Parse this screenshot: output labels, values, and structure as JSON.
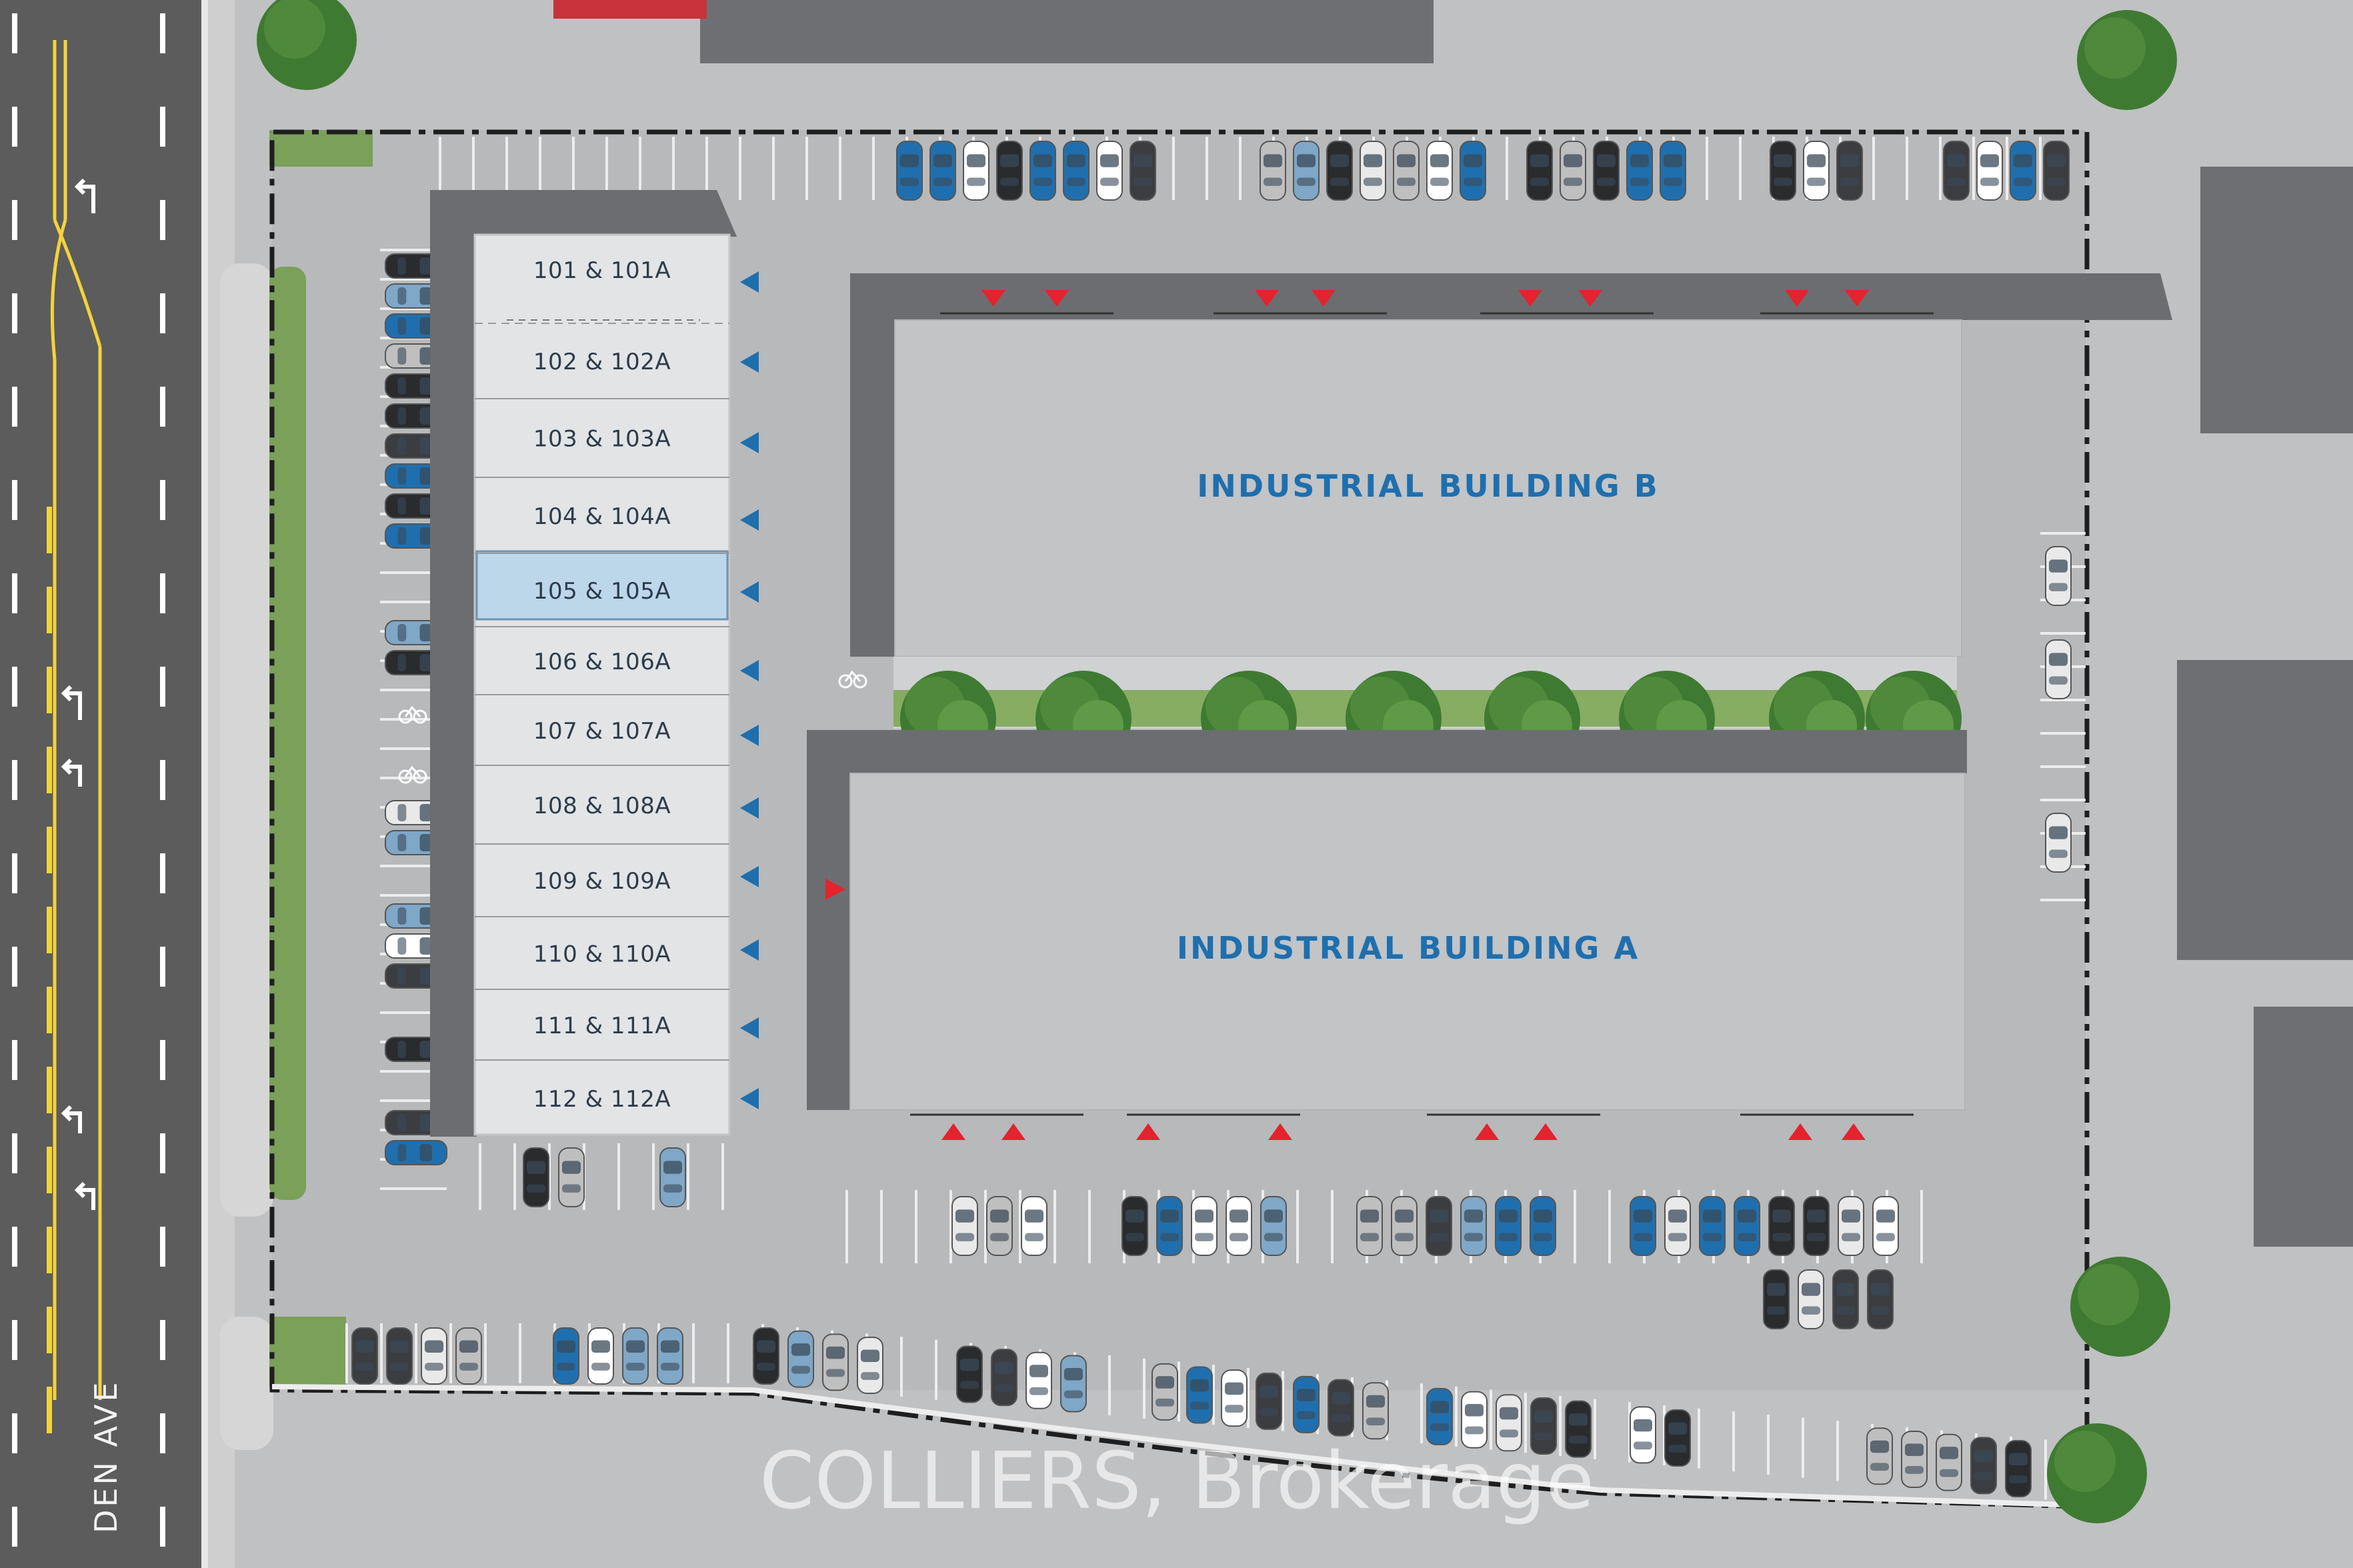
{
  "colors": {
    "accent": "#1f6fae",
    "selected_unit_fill": "#bcd7ea",
    "door_marker": "#e3232d",
    "entrance_arrow": "#1f6fae",
    "road": "#5c5c5c",
    "lane_yellow": "#f4d23c",
    "grass": "#7aa05a",
    "tree": "#4f8a3c"
  },
  "road": {
    "label": "DEN AVE"
  },
  "units": [
    {
      "label": "101 & 101A",
      "selected": false
    },
    {
      "label": "102 & 102A",
      "selected": false
    },
    {
      "label": "103 & 103A",
      "selected": false
    },
    {
      "label": "104 & 104A",
      "selected": false
    },
    {
      "label": "105 & 105A",
      "selected": true
    },
    {
      "label": "106 & 106A",
      "selected": false
    },
    {
      "label": "107 & 107A",
      "selected": false
    },
    {
      "label": "108 & 108A",
      "selected": false
    },
    {
      "label": "109 & 109A",
      "selected": false
    },
    {
      "label": "110 & 110A",
      "selected": false
    },
    {
      "label": "111 & 111A",
      "selected": false
    },
    {
      "label": "112 & 112A",
      "selected": false
    }
  ],
  "buildings": [
    {
      "id": "B",
      "label": "INDUSTRIAL BUILDING B"
    },
    {
      "id": "A",
      "label": "INDUSTRIAL BUILDING A"
    }
  ],
  "watermark": "COLLIERS, Brokerage",
  "icons": [
    "entrance-arrow-icon",
    "loading-door-icon",
    "bicycle-icon",
    "turn-arrow-icon",
    "car-icon",
    "tree-icon"
  ]
}
